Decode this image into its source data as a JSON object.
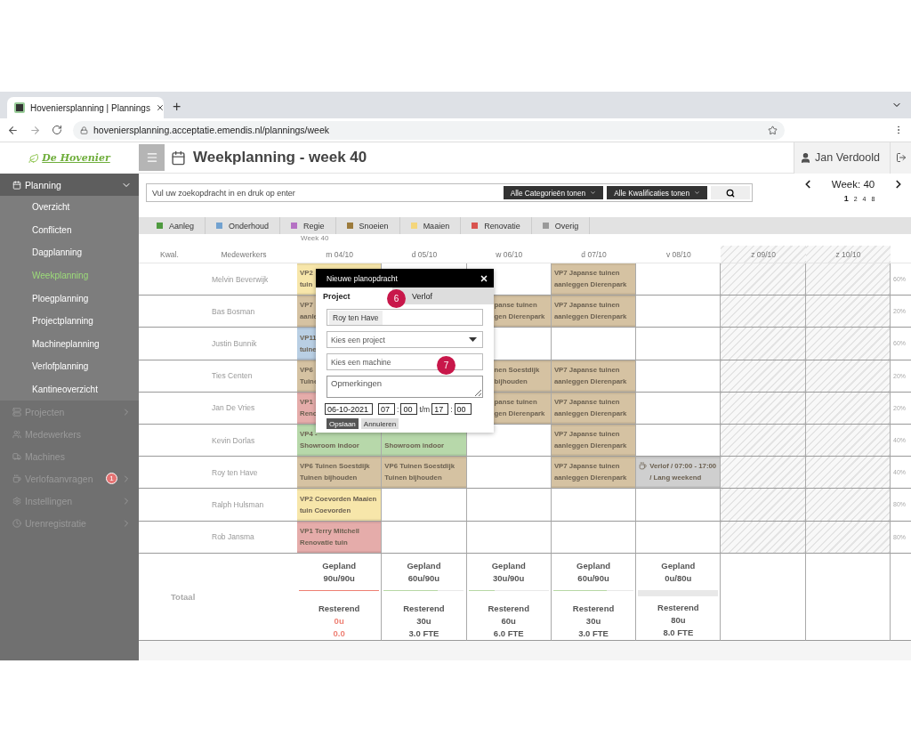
{
  "browser": {
    "tab_title": "Hoveniersplanning | Plannings",
    "new_tab": "+",
    "url": "hoveniersplanning.acceptatie.emendis.nl/plannings/week"
  },
  "logo": "De Hovenier",
  "header": {
    "title": "Weekplanning - week 40",
    "user": "Jan Verdoold"
  },
  "sidebar": [
    {
      "label": "Planning",
      "kind": "group",
      "expanded": true,
      "children": [
        {
          "label": "Overzicht",
          "selected": false
        },
        {
          "label": "Conflicten",
          "selected": false
        },
        {
          "label": "Dagplanning",
          "selected": false
        },
        {
          "label": "Weekplanning",
          "selected": true
        },
        {
          "label": "Ploegplanning",
          "selected": false
        },
        {
          "label": "Projectplanning",
          "selected": false
        },
        {
          "label": "Machineplanning",
          "selected": false
        },
        {
          "label": "Verlofplanning",
          "selected": false
        },
        {
          "label": "Kantineoverzicht",
          "selected": false
        }
      ]
    },
    {
      "label": "Projecten",
      "kind": "group",
      "expanded": false
    },
    {
      "label": "Medewerkers",
      "kind": "link"
    },
    {
      "label": "Machines",
      "kind": "link"
    },
    {
      "label": "Verlofaanvragen",
      "kind": "group",
      "expanded": false,
      "badge": "1"
    },
    {
      "label": "Instellingen",
      "kind": "group",
      "expanded": false
    },
    {
      "label": "Urenregistratie",
      "kind": "group",
      "expanded": false
    }
  ],
  "search": {
    "placeholder": "Vul uw zoekopdracht in en druk op enter",
    "filters": [
      "Alle Categorieën tonen",
      "Alle Kwalificaties tonen"
    ]
  },
  "week_nav": {
    "label": "Week: 40",
    "zoom": [
      {
        "label": "1",
        "selected": true
      },
      {
        "label": "2",
        "selected": false
      },
      {
        "label": "4",
        "selected": false
      },
      {
        "label": "8",
        "selected": false
      }
    ]
  },
  "legend": [
    {
      "label": "Aanleg",
      "color": "#4e9a3f"
    },
    {
      "label": "Onderhoud",
      "color": "#72a2d0"
    },
    {
      "label": "Regie",
      "color": "#b572c4"
    },
    {
      "label": "Snoeien",
      "color": "#9c7b3c"
    },
    {
      "label": "Maaien",
      "color": "#f4d67c"
    },
    {
      "label": "Renovatie",
      "color": "#d9534f"
    },
    {
      "label": "Overig",
      "color": "#9a9a9a"
    }
  ],
  "grid": {
    "week_label": "Week 40",
    "qual_header": "Kwal.",
    "staff_header": "Medewerkers",
    "days": [
      {
        "label": "m 04/10",
        "weekend": false
      },
      {
        "label": "d 05/10",
        "weekend": false
      },
      {
        "label": "w 06/10",
        "weekend": false
      },
      {
        "label": "d 07/10",
        "weekend": false
      },
      {
        "label": "v 08/10",
        "weekend": false
      },
      {
        "label": "z 09/10",
        "weekend": true
      },
      {
        "label": "z 10/10",
        "weekend": true
      }
    ],
    "rows": [
      {
        "name": "Melvin Beverwijk",
        "load": "60%",
        "cells": [
          {
            "kind": "task",
            "color": "#f7e6aa",
            "lines": [
              "VP2",
              "tuin"
            ]
          },
          {
            "kind": "empty"
          },
          {
            "kind": "empty"
          },
          {
            "kind": "task",
            "color": "#d5c2a2",
            "lines": [
              "VP7 Japanse tuinen",
              "aanleggen Dierenpark"
            ]
          },
          {
            "kind": "empty"
          }
        ]
      },
      {
        "name": "Bas Bosman",
        "load": "20%",
        "cells": [
          {
            "kind": "task",
            "color": "#d5c2a2",
            "lines": [
              "VP7",
              "aanle"
            ]
          },
          {
            "kind": "covered"
          },
          {
            "kind": "task_cut",
            "color": "#d5c2a2",
            "lines": [
              "panse tuinen",
              "gen Dierenpark"
            ]
          },
          {
            "kind": "task",
            "color": "#d5c2a2",
            "lines": [
              "VP7 Japanse tuinen",
              "aanleggen Dierenpark"
            ]
          },
          {
            "kind": "empty"
          }
        ]
      },
      {
        "name": "Justin Bunnik",
        "load": "60%",
        "cells": [
          {
            "kind": "task",
            "color": "#b9cfe4",
            "lines": [
              "VP11",
              "tuine"
            ]
          },
          {
            "kind": "covered"
          },
          {
            "kind": "empty"
          },
          {
            "kind": "empty"
          },
          {
            "kind": "empty"
          }
        ]
      },
      {
        "name": "Ties Centen",
        "load": "20%",
        "cells": [
          {
            "kind": "task",
            "color": "#d5c2a2",
            "lines": [
              "VP6",
              "Tuine"
            ]
          },
          {
            "kind": "covered"
          },
          {
            "kind": "task_cut",
            "color": "#d5c2a2",
            "lines": [
              "nen Soestdijk",
              "bijhouden"
            ]
          },
          {
            "kind": "task",
            "color": "#d5c2a2",
            "lines": [
              "VP7 Japanse tuinen",
              "aanleggen Dierenpark"
            ]
          },
          {
            "kind": "empty"
          }
        ]
      },
      {
        "name": "Jan De Vries",
        "load": "20%",
        "cells": [
          {
            "kind": "task",
            "color": "#e5acaa",
            "lines": [
              "VP1",
              "Reno"
            ]
          },
          {
            "kind": "covered"
          },
          {
            "kind": "task_cut",
            "color": "#d5c2a2",
            "lines": [
              "panse tuinen",
              "gen Dierenpark"
            ]
          },
          {
            "kind": "task",
            "color": "#d5c2a2",
            "lines": [
              "VP7 Japanse tuinen",
              "aanleggen Dierenpark"
            ]
          },
          {
            "kind": "empty"
          }
        ]
      },
      {
        "name": "Kevin Dorlas",
        "load": "40%",
        "cells": [
          {
            "kind": "task",
            "color": "#b7d8aa",
            "lines": [
              "VP4 -",
              "Showroom indoor"
            ]
          },
          {
            "kind": "task",
            "color": "#b7d8aa",
            "lines": [
              "Showroom indoor"
            ]
          },
          {
            "kind": "empty"
          },
          {
            "kind": "task",
            "color": "#d5c2a2",
            "lines": [
              "VP7 Japanse tuinen",
              "aanleggen Dierenpark"
            ]
          },
          {
            "kind": "empty"
          }
        ]
      },
      {
        "name": "Roy ten Have",
        "load": "40%",
        "cells": [
          {
            "kind": "task",
            "color": "#d5c2a2",
            "lines": [
              "VP6 Tuinen Soestdijk",
              "Tuinen bijhouden"
            ]
          },
          {
            "kind": "task",
            "color": "#d5c2a2",
            "lines": [
              "VP6 Tuinen Soestdijk",
              "Tuinen bijhouden"
            ]
          },
          {
            "kind": "empty"
          },
          {
            "kind": "task",
            "color": "#d5c2a2",
            "lines": [
              "VP7 Japanse tuinen",
              "aanleggen Dierenpark"
            ]
          },
          {
            "kind": "leave",
            "color": "#cfcfcf",
            "lines": [
              "Verlof / 07:00 - 17:00",
              "/ Lang weekend"
            ]
          }
        ]
      },
      {
        "name": "Ralph Hulsman",
        "load": "80%",
        "cells": [
          {
            "kind": "task",
            "color": "#f7e6aa",
            "lines": [
              "VP2 Coevorden Maaien",
              "tuin Coevorden"
            ]
          },
          {
            "kind": "empty"
          },
          {
            "kind": "empty"
          },
          {
            "kind": "empty"
          },
          {
            "kind": "empty"
          }
        ]
      },
      {
        "name": "Rob Jansma",
        "load": "80%",
        "cells": [
          {
            "kind": "task",
            "color": "#e5acaa",
            "lines": [
              "VP1 Terry Mitchell",
              "Renovatie tuin"
            ]
          },
          {
            "kind": "empty"
          },
          {
            "kind": "empty"
          },
          {
            "kind": "empty"
          },
          {
            "kind": "empty"
          }
        ]
      }
    ],
    "totals_label": "Totaal",
    "totals": [
      {
        "planned_label": "Gepland",
        "planned": "90u/90u",
        "level": 1,
        "over": true,
        "remaining_label": "Resterend",
        "remaining": "0u",
        "fte": "0.0"
      },
      {
        "planned_label": "Gepland",
        "planned": "60u/90u",
        "level": 0.67,
        "over": false,
        "remaining_label": "Resterend",
        "remaining": "30u",
        "fte": "3.0 FTE"
      },
      {
        "planned_label": "Gepland",
        "planned": "30u/90u",
        "level": 0.33,
        "over": false,
        "remaining_label": "Resterend",
        "remaining": "60u",
        "fte": "6.0 FTE"
      },
      {
        "planned_label": "Gepland",
        "planned": "60u/90u",
        "level": 0.67,
        "over": false,
        "remaining_label": "Resterend",
        "remaining": "30u",
        "fte": "3.0 FTE"
      },
      {
        "planned_label": "Gepland",
        "planned": "0u/80u",
        "level": 0,
        "over": false,
        "remaining_label": "Resterend",
        "remaining": "80u",
        "fte": "8.0 FTE"
      }
    ]
  },
  "modal": {
    "title": "Nieuwe planopdracht",
    "tabs": [
      {
        "label": "Project",
        "selected": true
      },
      {
        "label": "Verlof",
        "selected": false
      }
    ],
    "employee": "Roy ten Have",
    "project_placeholder": "Kies een project",
    "machine_placeholder": "Kies een machine",
    "notes_placeholder": "Opmerkingen",
    "date": "06-10-2021",
    "start_hour": "07",
    "start_minute": "00",
    "until": "t/m",
    "end_hour": "17",
    "end_minute": "00",
    "separators": [
      ":",
      ":"
    ],
    "buttons": [
      "Opslaan",
      "Annuleren"
    ]
  },
  "callouts": [
    {
      "label": "6"
    },
    {
      "label": "7"
    }
  ]
}
